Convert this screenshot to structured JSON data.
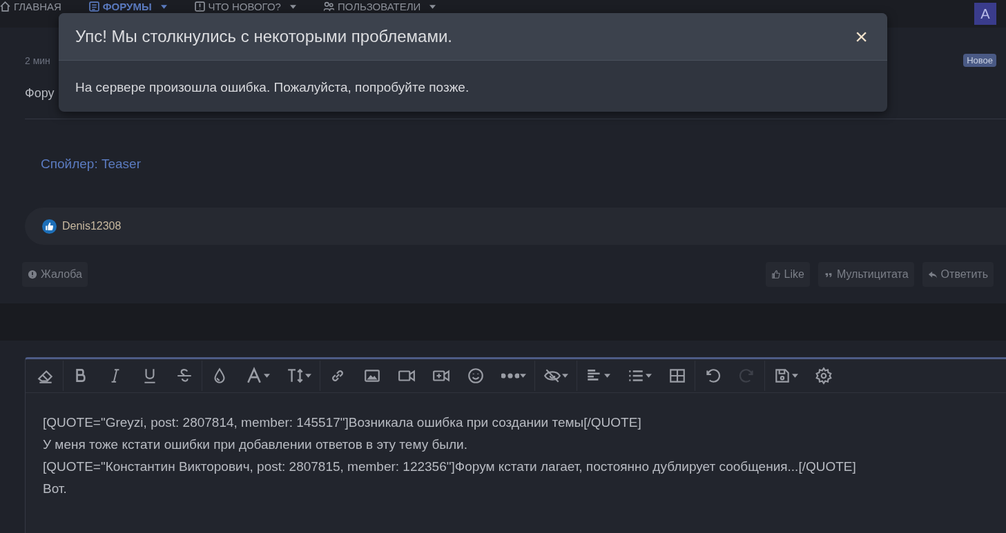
{
  "nav": {
    "items": [
      {
        "label": "ГЛАВНАЯ",
        "kind": "home",
        "selected": false,
        "dropdown": false
      },
      {
        "label": "ФОРУМЫ",
        "kind": "forum",
        "selected": true,
        "dropdown": true
      },
      {
        "label": "ЧТО НОВОГО?",
        "kind": "new",
        "selected": false,
        "dropdown": true
      },
      {
        "label": "ПОЛЬЗОВАТЕЛИ",
        "kind": "users",
        "selected": false,
        "dropdown": true
      }
    ],
    "avatar": "A"
  },
  "post": {
    "time": "2 мин",
    "badge": "Новое",
    "text": "Фору",
    "spoiler": "Спойлер: Teaser",
    "reaction_user": "Denis12308",
    "report": "Жалоба",
    "actions": [
      {
        "kind": "like",
        "label": "Like"
      },
      {
        "kind": "quote",
        "label": "Мультицитата"
      },
      {
        "kind": "reply",
        "label": "Ответить"
      }
    ]
  },
  "editor": {
    "tools": [
      {
        "kind": "eraser",
        "dropdown": false,
        "disabled": false,
        "sep": true
      },
      {
        "kind": "bold",
        "dropdown": false,
        "disabled": false,
        "sep": false
      },
      {
        "kind": "italic",
        "dropdown": false,
        "disabled": false,
        "sep": false
      },
      {
        "kind": "underline",
        "dropdown": false,
        "disabled": false,
        "sep": false
      },
      {
        "kind": "strike",
        "dropdown": false,
        "disabled": false,
        "sep": true
      },
      {
        "kind": "color",
        "dropdown": false,
        "disabled": false,
        "sep": false
      },
      {
        "kind": "font",
        "dropdown": true,
        "disabled": false,
        "sep": false
      },
      {
        "kind": "size",
        "dropdown": true,
        "disabled": false,
        "sep": true
      },
      {
        "kind": "link",
        "dropdown": false,
        "disabled": false,
        "sep": false
      },
      {
        "kind": "image",
        "dropdown": false,
        "disabled": false,
        "sep": false
      },
      {
        "kind": "video",
        "dropdown": false,
        "disabled": false,
        "sep": false
      },
      {
        "kind": "media",
        "dropdown": false,
        "disabled": false,
        "sep": false
      },
      {
        "kind": "smilie",
        "dropdown": false,
        "disabled": false,
        "sep": false
      },
      {
        "kind": "more",
        "dropdown": true,
        "disabled": false,
        "sep": true
      },
      {
        "kind": "hide",
        "dropdown": true,
        "disabled": false,
        "sep": true
      },
      {
        "kind": "align",
        "dropdown": true,
        "disabled": false,
        "sep": false
      },
      {
        "kind": "list",
        "dropdown": true,
        "disabled": false,
        "sep": false
      },
      {
        "kind": "table",
        "dropdown": false,
        "disabled": false,
        "sep": true
      },
      {
        "kind": "undo",
        "dropdown": false,
        "disabled": false,
        "sep": false
      },
      {
        "kind": "redo",
        "dropdown": false,
        "disabled": true,
        "sep": true
      },
      {
        "kind": "save",
        "dropdown": true,
        "disabled": false,
        "sep": false
      },
      {
        "kind": "settings",
        "dropdown": false,
        "disabled": false,
        "sep": false
      }
    ],
    "lines": [
      "[QUOTE=\"Greyzi, post: 2807814, member: 145517\"]Возникала ошибка при создании темы[/QUOTE]",
      "У меня тоже кстати ошибки при добавлении ответов в эту тему были.",
      "[QUOTE=\"Константин Викторович, post: 2807815, member: 122356\"]Форум кстати лагает, постоянно дублирует сообщения...[/QUOTE]",
      "Вот."
    ]
  },
  "modal": {
    "title": "Упс! Мы столкнулись с некоторыми проблемами.",
    "close": "×",
    "message": "На сервере произошла ошибка. Пожалуйста, попробуйте позже."
  }
}
